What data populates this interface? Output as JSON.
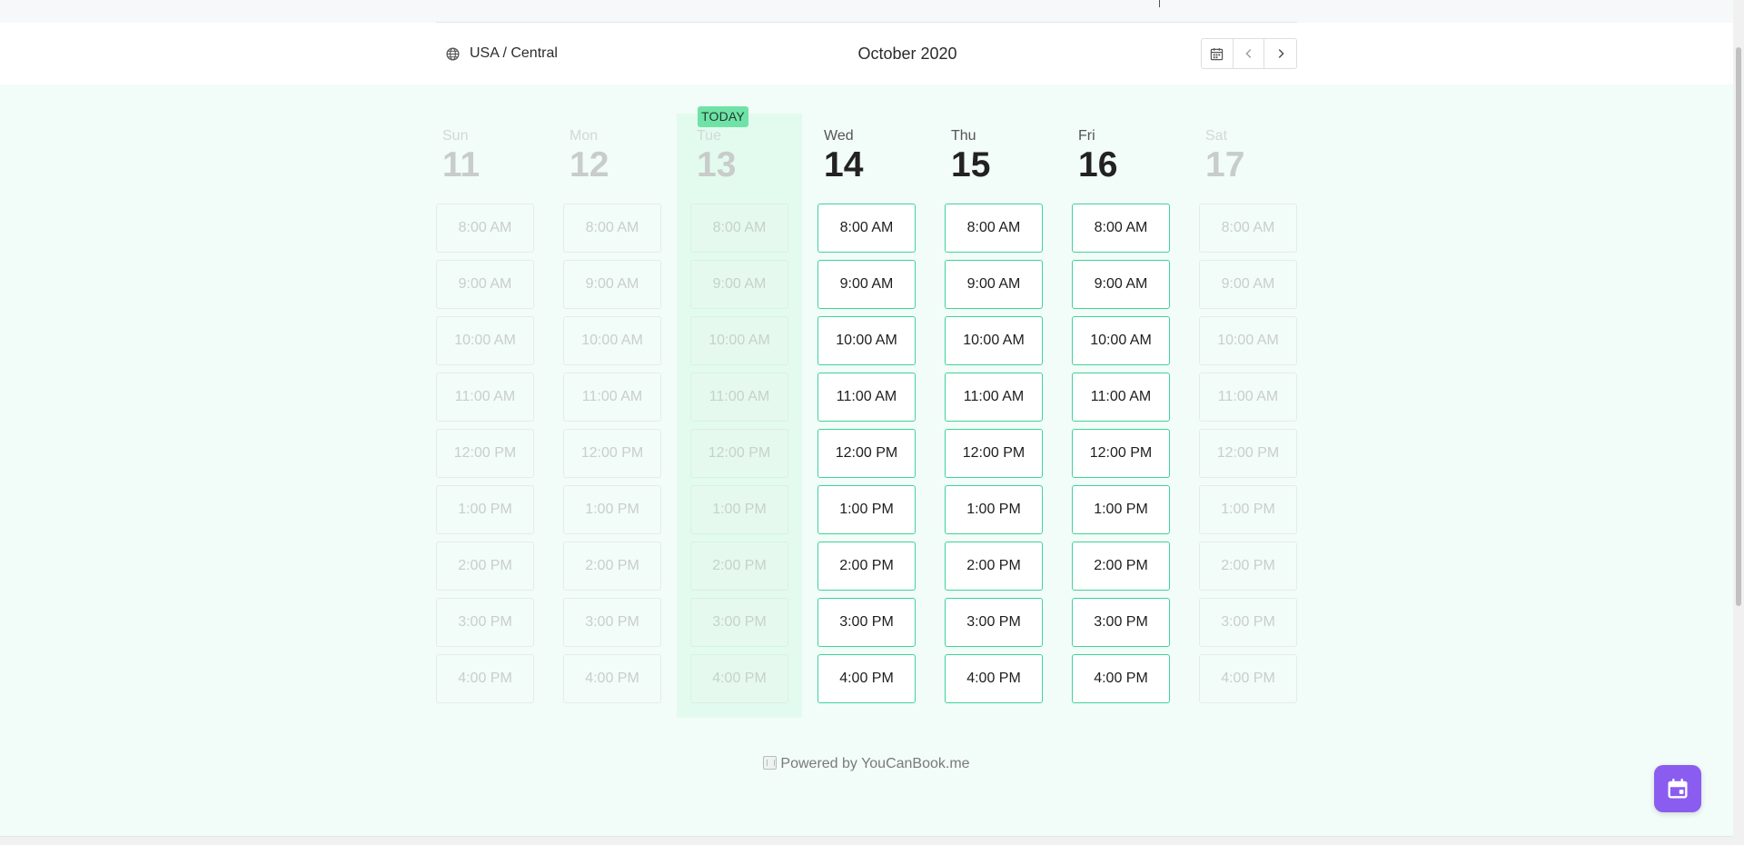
{
  "header": {
    "timezone": "USA / Central",
    "month": "October 2020"
  },
  "today_badge": "TODAY",
  "days": [
    {
      "name": "Sun",
      "num": "11",
      "state": "disabled"
    },
    {
      "name": "Mon",
      "num": "12",
      "state": "disabled"
    },
    {
      "name": "Tue",
      "num": "13",
      "state": "today"
    },
    {
      "name": "Wed",
      "num": "14",
      "state": "active"
    },
    {
      "name": "Thu",
      "num": "15",
      "state": "active"
    },
    {
      "name": "Fri",
      "num": "16",
      "state": "active"
    },
    {
      "name": "Sat",
      "num": "17",
      "state": "disabled"
    }
  ],
  "times": [
    "8:00 AM",
    "9:00 AM",
    "10:00 AM",
    "11:00 AM",
    "12:00 PM",
    "1:00 PM",
    "2:00 PM",
    "3:00 PM",
    "4:00 PM"
  ],
  "footer": {
    "text": "Powered by YouCanBook.me"
  },
  "colors": {
    "accent": "#3fd39a",
    "today_badge": "#6fe3a7",
    "fab": "#8b5cf0",
    "page_bg": "#f2fcf8"
  },
  "icons": {
    "timezone": "globe-icon",
    "calendar": "calendar-icon",
    "prev": "chevron-left-icon",
    "next": "chevron-right-icon",
    "fab": "calendar-icon"
  }
}
